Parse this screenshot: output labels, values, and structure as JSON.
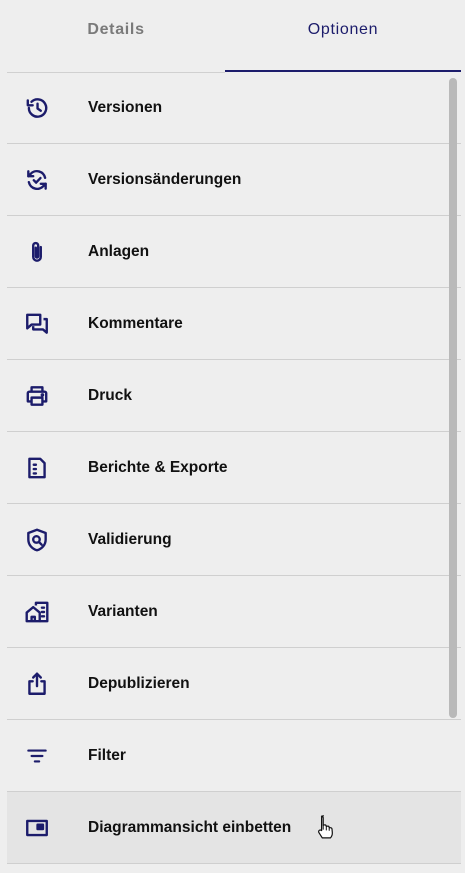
{
  "tabs": [
    {
      "label": "Details",
      "active": false
    },
    {
      "label": "Optionen",
      "active": true
    }
  ],
  "accent_color": "#1c1c6b",
  "items": [
    {
      "label": "Versionen",
      "icon": "history-icon"
    },
    {
      "label": "Versionsänderungen",
      "icon": "sync-check-icon"
    },
    {
      "label": "Anlagen",
      "icon": "paperclip-icon"
    },
    {
      "label": "Kommentare",
      "icon": "comments-icon"
    },
    {
      "label": "Druck",
      "icon": "printer-icon"
    },
    {
      "label": "Berichte & Exporte",
      "icon": "report-document-icon"
    },
    {
      "label": "Validierung",
      "icon": "shield-search-icon"
    },
    {
      "label": "Varianten",
      "icon": "buildings-icon"
    },
    {
      "label": "Depublizieren",
      "icon": "share-upload-icon"
    },
    {
      "label": "Filter",
      "icon": "filter-icon"
    },
    {
      "label": "Diagrammansicht einbetten",
      "icon": "embed-window-icon",
      "hovered": true
    }
  ]
}
